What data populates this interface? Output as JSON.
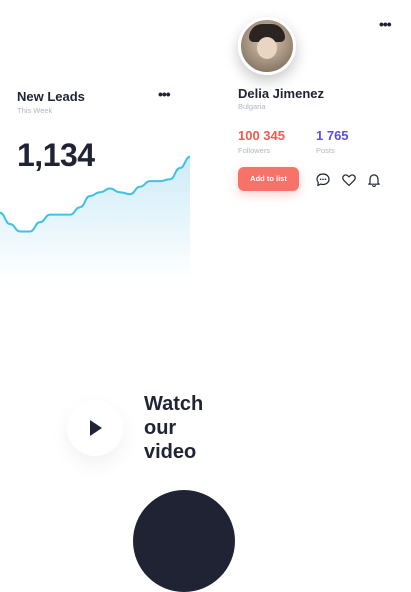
{
  "leads": {
    "title": "New Leads",
    "subtitle": "This Week",
    "more_label": "•••",
    "value": "1,134"
  },
  "chart_data": {
    "type": "area",
    "x": [
      0,
      1,
      2,
      3,
      4,
      5,
      6,
      7,
      8,
      9,
      10,
      11,
      12,
      13,
      14,
      15,
      16,
      17,
      18,
      19
    ],
    "values": [
      36,
      30,
      26,
      26,
      31,
      35,
      35,
      35,
      39,
      45,
      47,
      49,
      47,
      46,
      50,
      53,
      53,
      54,
      60,
      66
    ],
    "ylim": [
      0,
      75
    ],
    "line_color": "#3fc1e6",
    "fill_color": "#d4eff8",
    "title": "",
    "xlabel": "",
    "ylabel": ""
  },
  "profile": {
    "name": "Delia Jimenez",
    "country": "Bulgaria",
    "more_label": "•••",
    "followers_value": "100 345",
    "followers_label": "Followers",
    "posts_value": "1 765",
    "posts_label": "Posts",
    "add_button": "Add to list",
    "icons": [
      "chat-icon",
      "heart-icon",
      "bell-icon"
    ],
    "colors": {
      "followers": "#f05a4f",
      "posts": "#5b4fe0",
      "button": "#f77268"
    }
  },
  "video": {
    "line1": "Watch",
    "line2": "our",
    "line3": "video"
  }
}
